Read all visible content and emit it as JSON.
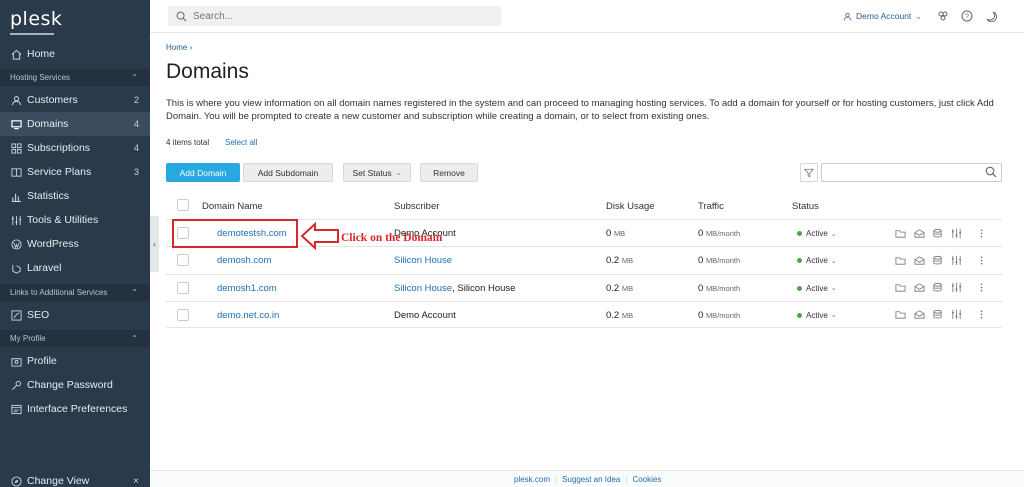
{
  "app": {
    "logo": "plesk"
  },
  "sidebar": {
    "home": "Home",
    "hosting_section": "Hosting Services",
    "customers": {
      "label": "Customers",
      "count": "2"
    },
    "domains": {
      "label": "Domains",
      "count": "4"
    },
    "subscriptions": {
      "label": "Subscriptions",
      "count": "4"
    },
    "service_plans": {
      "label": "Service Plans",
      "count": "3"
    },
    "statistics": "Statistics",
    "tools": "Tools & Utilities",
    "wordpress": "WordPress",
    "laravel": "Laravel",
    "links_section": "Links to Additional Services",
    "seo": "SEO",
    "profile_section": "My Profile",
    "profile": "Profile",
    "change_password": "Change Password",
    "interface_prefs": "Interface Preferences",
    "change_view": "Change View"
  },
  "topbar": {
    "search_placeholder": "Search...",
    "account": "Demo Account"
  },
  "main": {
    "breadcrumb": "Home",
    "title": "Domains",
    "intro": "This is where you view information on all domain names registered in the system and can proceed to managing hosting services. To add a domain for yourself or for hosting customers, just click Add Domain. You will be prompted to create a new customer and subscription while creating a domain, or to select from existing ones.",
    "items_total": "4 items total",
    "select_all": "Select all",
    "buttons": {
      "add_domain": "Add Domain",
      "add_subdomain": "Add Subdomain",
      "set_status": "Set Status",
      "remove": "Remove"
    }
  },
  "table": {
    "headers": {
      "domain_name": "Domain Name",
      "subscriber": "Subscriber",
      "disk_usage": "Disk Usage",
      "traffic": "Traffic",
      "status": "Status"
    },
    "rows": [
      {
        "domain": "demotestsh.com",
        "subscriber": "Demo Account",
        "subscriber2": "",
        "disk": "0",
        "disk_unit": "MB",
        "traffic": "0",
        "traffic_unit": "MB/month",
        "status": "Active"
      },
      {
        "domain": "demosh.com",
        "subscriber": "Silicon House",
        "subscriber2": "",
        "disk": "0.2",
        "disk_unit": "MB",
        "traffic": "0",
        "traffic_unit": "MB/month",
        "status": "Active"
      },
      {
        "domain": "demosh1.com",
        "subscriber": "Silicon House",
        "subscriber2": ", Silicon House",
        "disk": "0.2",
        "disk_unit": "MB",
        "traffic": "0",
        "traffic_unit": "MB/month",
        "status": "Active"
      },
      {
        "domain": "demo.net.co.in",
        "subscriber": "Demo Account",
        "subscriber2": "",
        "disk": "0.2",
        "disk_unit": "MB",
        "traffic": "0",
        "traffic_unit": "MB/month",
        "status": "Active"
      }
    ]
  },
  "annotation": {
    "text": "Click on the Domain",
    "color": "#d9262b"
  },
  "footer": {
    "link1": "plesk.com",
    "link2": "Suggest an Idea",
    "link3": "Cookies"
  },
  "colors": {
    "sidebar_bg": "#2b3a4a",
    "primary": "#28a8e0",
    "link": "#1f6fb5",
    "active_dot": "#4aa845"
  }
}
